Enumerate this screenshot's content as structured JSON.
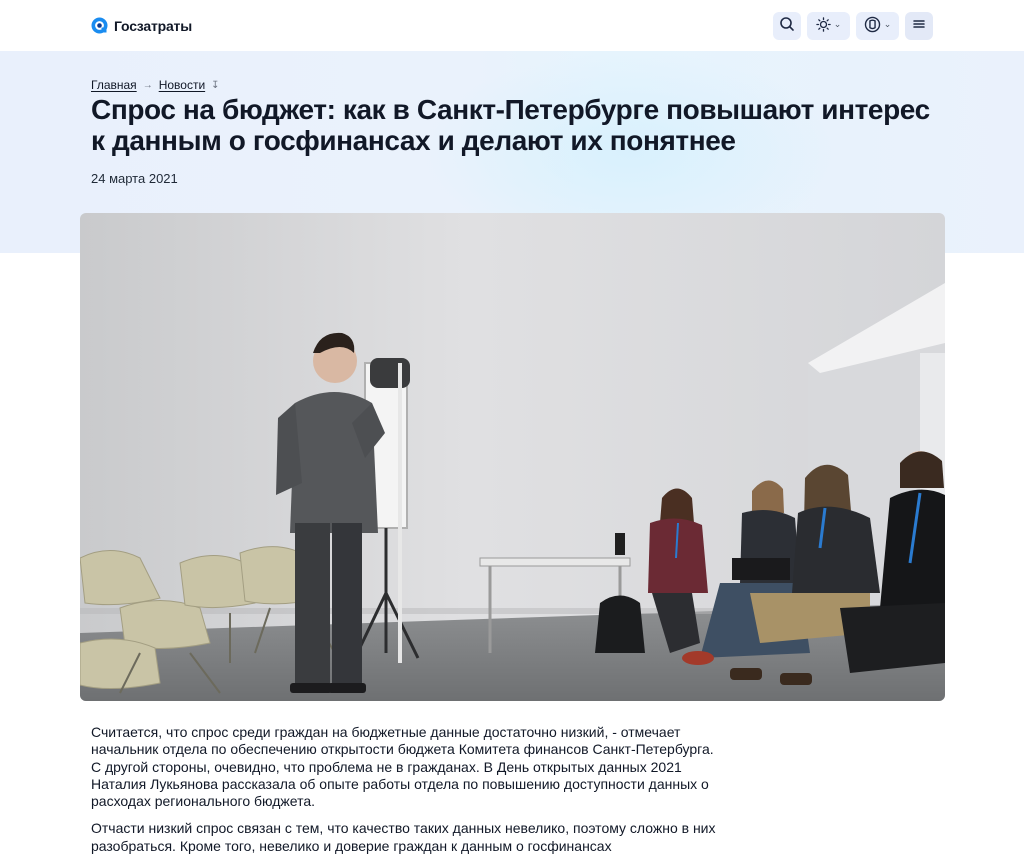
{
  "header": {
    "brand": "Госзатраты",
    "actions": [
      {
        "icon": "search-icon"
      },
      {
        "icon": "sun-icon",
        "has_dropdown": true
      },
      {
        "icon": "accessibility-icon",
        "has_dropdown": true
      },
      {
        "icon": "menu-icon"
      }
    ]
  },
  "breadcrumb": {
    "items": [
      "Главная",
      "Новости"
    ],
    "separator_icon": "arrow-right-icon",
    "trail_icon": "arrow-down-icon"
  },
  "article": {
    "title": "Спрос на бюджет: как в Санкт-Петербурге повышают интерес к данным о госфинансах и делают их понятнее",
    "date": "24 марта 2021",
    "image": "photo-speaker-presentation",
    "paragraphs": [
      "Считается, что спрос среди граждан на бюджетные данные достаточно низкий, - отмечает начальник отдела по обеспечению открытости бюджета Комитета финансов Санкт-Петербурга. С другой стороны, очевидно, что проблема не в гражданах. В День открытых данных 2021 Наталия Лукьянова рассказала об опыте работы отдела по повышению доступности данных о расходах регионального бюджета.",
      "Отчасти низкий спрос связан с тем, что качество таких данных невелико, поэтому сложно в них разобраться. Кроме того, невелико и доверие граждан к данным о госфинансах"
    ]
  },
  "colors": {
    "accent": "#1a73e8",
    "hero_bg": "#eaf1fc",
    "button_bg": "#e8eefb"
  }
}
